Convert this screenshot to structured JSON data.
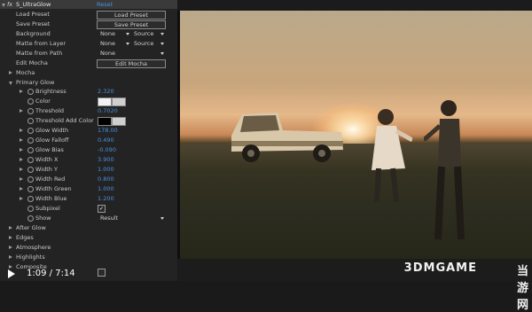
{
  "effect": {
    "name": "S_UltraGlow",
    "reset": "Reset",
    "load_preset": {
      "label": "Load Preset",
      "button": "Load Preset"
    },
    "save_preset": {
      "label": "Save Preset",
      "button": "Save Preset"
    },
    "background": {
      "label": "Background",
      "value": "None",
      "source": "Source"
    },
    "matte_layer": {
      "label": "Matte from Layer",
      "value": "None",
      "source": "Source"
    },
    "matte_path": {
      "label": "Matte from Path",
      "value": "None"
    },
    "edit_mocha": {
      "label": "Edit Mocha",
      "button": "Edit Mocha"
    },
    "mocha": "Mocha",
    "primary_glow": "Primary Glow",
    "params": [
      {
        "label": "Brightness",
        "value": "2.320"
      },
      {
        "label": "Color",
        "value": ""
      },
      {
        "label": "Threshold",
        "value": "0.7020"
      },
      {
        "label": "Threshold Add Color",
        "value": ""
      },
      {
        "label": "Glow Width",
        "value": "178.00"
      },
      {
        "label": "Glow Falloff",
        "value": "0.490"
      },
      {
        "label": "Glow Bias",
        "value": "-0.090"
      },
      {
        "label": "Width X",
        "value": "3.900"
      },
      {
        "label": "Width Y",
        "value": "1.000"
      },
      {
        "label": "Width Red",
        "value": "0.800"
      },
      {
        "label": "Width Green",
        "value": "1.000"
      },
      {
        "label": "Width Blue",
        "value": "1.200"
      },
      {
        "label": "Subpixel",
        "value": ""
      },
      {
        "label": "Show",
        "value": "Result"
      }
    ],
    "groups": [
      "After Glow",
      "Edges",
      "Atmosphere",
      "Highlights",
      "Composite"
    ],
    "colors": {
      "color_swatch": "#f2f2f2",
      "threshold_swatch": "#000000",
      "accent": "#4a8fe0"
    }
  },
  "player": {
    "time_current": "1:09",
    "time_separator": " / ",
    "time_total": "7:14",
    "state": "paused",
    "progress": 0.159
  },
  "watermark": {
    "logo": "3DMGAME",
    "name": "当游网"
  }
}
